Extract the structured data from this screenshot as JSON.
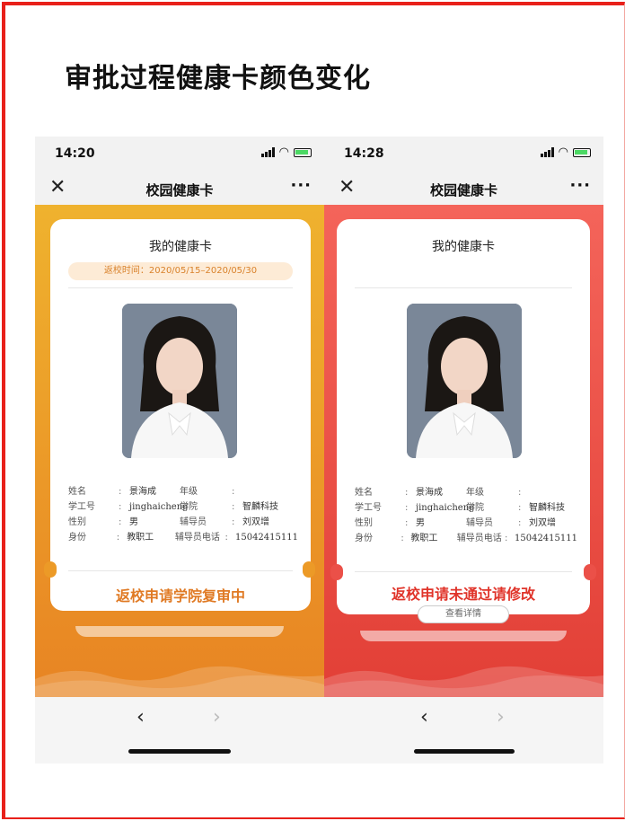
{
  "heading": "审批过程健康卡颜色变化",
  "phones": [
    {
      "time": "14:20",
      "nav_title": "校园健康卡",
      "more": "···",
      "card_title": "我的健康卡",
      "return_time": "返校时间：2020/05/15–2020/05/30",
      "info": {
        "name_label": "姓名",
        "name": "景海成",
        "grade_label": "年级",
        "grade": "",
        "id_label": "学工号",
        "id": "jinghaicheng",
        "college_label": "学院",
        "college": "智麟科技",
        "gender_label": "性别",
        "gender": "男",
        "counselor_label": "辅导员",
        "counselor": "刘双增",
        "role_label": "身份",
        "role": "教职工",
        "phone_label": "辅导员电话",
        "phone": "15042415111",
        "colon": ":"
      },
      "status": "返校申请学院复审中",
      "status_color": "#e07a24",
      "back": "‹",
      "forward": "›"
    },
    {
      "time": "14:28",
      "nav_title": "校园健康卡",
      "more": "···",
      "card_title": "我的健康卡",
      "info": {
        "name_label": "姓名",
        "name": "景海成",
        "grade_label": "年级",
        "grade": "",
        "id_label": "学工号",
        "id": "jinghaicheng",
        "college_label": "学院",
        "college": "智麟科技",
        "gender_label": "性别",
        "gender": "男",
        "counselor_label": "辅导员",
        "counselor": "刘双增",
        "role_label": "身份",
        "role": "教职工",
        "phone_label": "辅导员电话",
        "phone": "15042415111",
        "colon": ":"
      },
      "status": "返校申请未通过请修改",
      "status_color": "#e0342a",
      "detail_button": "查看详情",
      "back": "‹",
      "forward": "›"
    }
  ]
}
